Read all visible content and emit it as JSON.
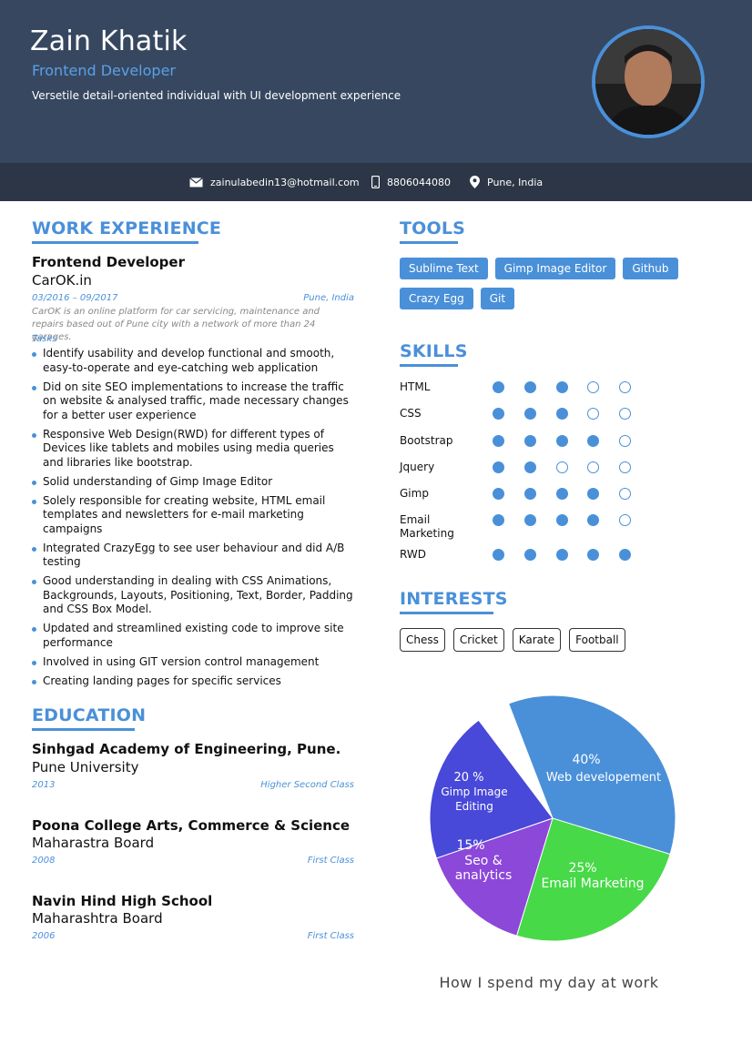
{
  "header": {
    "name": "Zain Khatik",
    "role": "Frontend Developer",
    "tagline": "Versetile detail-oriented individual with UI development experience"
  },
  "contact": {
    "email": "zainulabedin13@hotmail.com",
    "phone": "8806044080",
    "location": "Pune, India"
  },
  "work": {
    "section_title": "WORK EXPERIENCE",
    "title": "Frontend Developer",
    "company": "CarOK.in",
    "dates": "03/2016 – 09/2017",
    "location": "Pune, India",
    "description": "CarOK is an online platform for car servicing, maintenance and repairs based out of Pune city with a network of more than 24 garages.",
    "tasks_label": "Tasks",
    "tasks": [
      "Identify usability and develop functional and smooth, easy-to-operate and eye-catching web application",
      "Did on site SEO implementations to increase the traffic on website & analysed traffic, made necessary changes for a better user experience",
      "Responsive Web Design(RWD) for different types of Devices like tablets and mobiles using media queries and libraries like bootstrap.",
      "Solid understanding of Gimp Image Editor",
      "Solely responsible for creating website, HTML email templates and newsletters for e-mail marketing campaigns",
      "Integrated CrazyEgg to see user behaviour and did A/B testing",
      "Good understanding in dealing with CSS Animations, Backgrounds, Layouts, Positioning, Text, Border, Padding and CSS Box Model.",
      "Updated and streamlined existing code to improve site performance",
      "Involved in using GIT version control management",
      "Creating landing pages for specific services"
    ]
  },
  "education": {
    "section_title": "EDUCATION",
    "entries": [
      {
        "school": "Sinhgad Academy of Engineering, Pune.",
        "board": "Pune University",
        "year": "2013",
        "grade": "Higher Second Class"
      },
      {
        "school": "Poona College Arts, Commerce & Science",
        "board": "Maharastra Board",
        "year": "2008",
        "grade": "First Class"
      },
      {
        "school": "Navin Hind High School",
        "board": "Maharashtra Board",
        "year": "2006",
        "grade": "First Class"
      }
    ]
  },
  "tools": {
    "section_title": "TOOLS",
    "items": [
      "Sublime Text",
      "Gimp Image Editor",
      "Github",
      "Crazy Egg",
      "Git"
    ]
  },
  "skills": {
    "section_title": "SKILLS",
    "max": 5,
    "items": [
      {
        "name": "HTML",
        "level": 3
      },
      {
        "name": "CSS",
        "level": 3
      },
      {
        "name": "Bootstrap",
        "level": 4
      },
      {
        "name": "Jquery",
        "level": 2
      },
      {
        "name": "Gimp",
        "level": 4
      },
      {
        "name": "Email Marketing",
        "level": 4
      },
      {
        "name": "RWD",
        "level": 5
      }
    ]
  },
  "interests": {
    "section_title": "INTERESTS",
    "items": [
      "Chess",
      "Cricket",
      "Karate",
      "Football"
    ]
  },
  "chart_data": {
    "type": "pie",
    "title": "How I spend my day at work",
    "slices": [
      {
        "label": "Web developement",
        "pct_label": "40%",
        "value": 40,
        "color": "#4a90d9"
      },
      {
        "label": "Email Marketing",
        "pct_label": "25%",
        "value": 25,
        "color": "#47d948"
      },
      {
        "label": "Seo & analytics",
        "pct_label": "15%",
        "value": 15,
        "color": "#8c48d9"
      },
      {
        "label": "Gimp Image Editing",
        "pct_label": "20 %",
        "value": 20,
        "color": "#4848d9"
      }
    ]
  },
  "colors": {
    "accent": "#4a90d9",
    "header_bg": "#374760",
    "contact_bg": "#2c3646"
  }
}
